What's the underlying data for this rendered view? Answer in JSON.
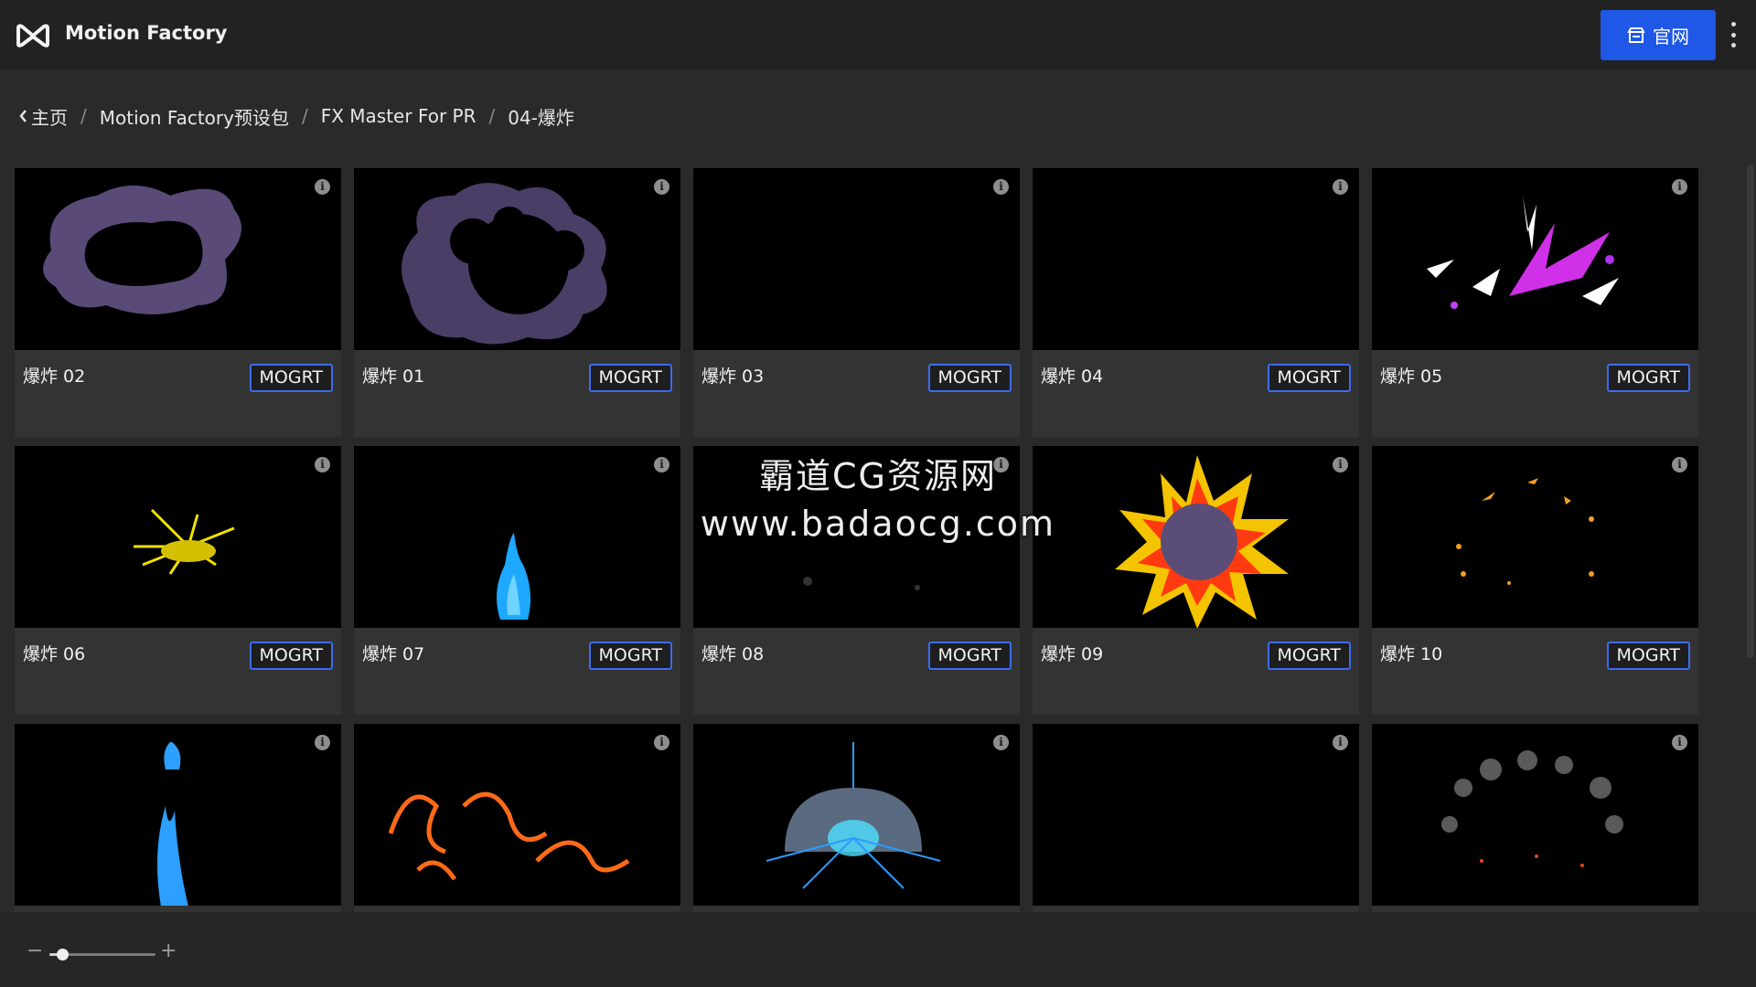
{
  "app": {
    "title": "Motion Factory",
    "site_button_label": "官网"
  },
  "breadcrumb": {
    "home": "主页",
    "items": [
      "Motion Factory预设包",
      "FX Master For PR",
      "04-爆炸"
    ],
    "separator": "/"
  },
  "items": [
    {
      "name": "爆炸 02",
      "badge": "MOGRT",
      "art": "smoke-ring"
    },
    {
      "name": "爆炸 01",
      "badge": "MOGRT",
      "art": "smoke-flower"
    },
    {
      "name": "爆炸 03",
      "badge": "MOGRT",
      "art": "empty"
    },
    {
      "name": "爆炸 04",
      "badge": "MOGRT",
      "art": "empty"
    },
    {
      "name": "爆炸 05",
      "badge": "MOGRT",
      "art": "purple-burst"
    },
    {
      "name": "爆炸 06",
      "badge": "MOGRT",
      "art": "yellow-spikes"
    },
    {
      "name": "爆炸 07",
      "badge": "MOGRT",
      "art": "blue-flame"
    },
    {
      "name": "爆炸 08",
      "badge": "MOGRT",
      "art": "faint-dots"
    },
    {
      "name": "爆炸 09",
      "badge": "MOGRT",
      "art": "fire-star"
    },
    {
      "name": "爆炸 10",
      "badge": "MOGRT",
      "art": "spark-ring"
    },
    {
      "name": "",
      "badge": "",
      "art": "blue-column"
    },
    {
      "name": "",
      "badge": "",
      "art": "orange-swirls"
    },
    {
      "name": "",
      "badge": "",
      "art": "energy-dome"
    },
    {
      "name": "",
      "badge": "",
      "art": "empty"
    },
    {
      "name": "",
      "badge": "",
      "art": "debris-arc"
    }
  ],
  "watermark": {
    "line1": "霸道CG资源网",
    "line2": "www.badaocg.com"
  },
  "zoom": {
    "level": 0.12,
    "minus": "−",
    "plus": "+"
  },
  "colors": {
    "accent": "#1f57e6",
    "badge_border": "#3c6cf0",
    "card": "#333333",
    "thumb": "#000000"
  }
}
